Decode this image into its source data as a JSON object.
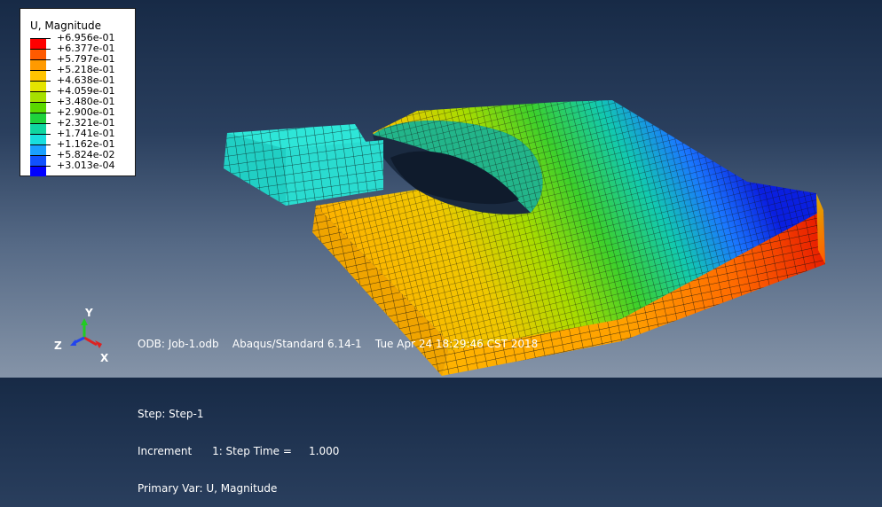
{
  "legend": {
    "title": "U, Magnitude",
    "entries": [
      {
        "label": "+6.956e-01",
        "color": "#ff0000"
      },
      {
        "label": "+6.377e-01",
        "color": "#ff5a00"
      },
      {
        "label": "+5.797e-01",
        "color": "#ff9a00"
      },
      {
        "label": "+5.218e-01",
        "color": "#ffc400"
      },
      {
        "label": "+4.638e-01",
        "color": "#e4e400"
      },
      {
        "label": "+4.059e-01",
        "color": "#a6e000"
      },
      {
        "label": "+3.480e-01",
        "color": "#5ad800"
      },
      {
        "label": "+2.900e-01",
        "color": "#1ed23c"
      },
      {
        "label": "+2.321e-01",
        "color": "#0fd6a0"
      },
      {
        "label": "+1.741e-01",
        "color": "#18dede"
      },
      {
        "label": "+1.162e-01",
        "color": "#1a9fff"
      },
      {
        "label": "+5.824e-02",
        "color": "#1050ff"
      },
      {
        "label": "+3.013e-04",
        "color": "#0000ff"
      }
    ]
  },
  "info": {
    "odb_line": "ODB: Job-1.odb    Abaqus/Standard 6.14-1    Tue Apr 24 18:29:46 CST 2018",
    "step_line": "Step: Step-1",
    "increment_line": "Increment      1: Step Time =     1.000",
    "var_line": "Primary Var: U, Magnitude"
  },
  "triad": {
    "x_label": "X",
    "y_label": "Y",
    "z_label": "Z"
  },
  "colors": {
    "background_top": "#172a46",
    "background_bottom": "#8594a8",
    "mesh_line": "#101010"
  }
}
